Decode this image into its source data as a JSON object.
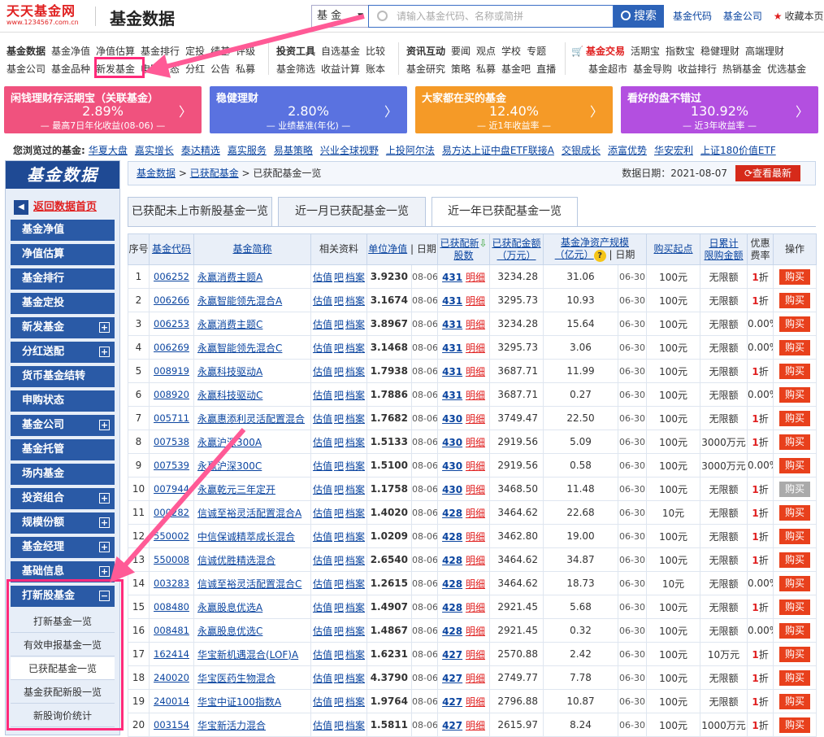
{
  "header": {
    "logo_text": "天天基金网",
    "logo_url": "www.1234567.com.cn",
    "site_title": "基金数据",
    "search_type": "基 金",
    "search_placeholder": "请输入基金代码、名称或简拼",
    "search_button": "搜索",
    "link_code": "基金代码",
    "link_company": "基金公司",
    "bookmark": "收藏本页"
  },
  "nav": {
    "g1r1": [
      "基金数据",
      "基金净值",
      "净值估算",
      "基金排行",
      "定投",
      "绩基",
      "评级"
    ],
    "g1r2": [
      "基金公司",
      "基金品种",
      "新发基金",
      "申购状态",
      "分红",
      "公告",
      "私募"
    ],
    "g2r1": [
      "投资工具",
      "自选基金",
      "比较"
    ],
    "g2r2": [
      "基金筛选",
      "收益计算",
      "账本"
    ],
    "g3r1": [
      "资讯互动",
      "要闻",
      "观点",
      "学校",
      "专题"
    ],
    "g3r2": [
      "基金研究",
      "策略",
      "私募",
      "基金吧",
      "直播"
    ],
    "g4r1": [
      "基金交易",
      "活期宝",
      "指数宝",
      "稳健理财",
      "高端理财"
    ],
    "g4r2": [
      "基金超市",
      "基金导购",
      "收益排行",
      "热销基金",
      "优选基金"
    ]
  },
  "banners": [
    {
      "title": "闲钱理财存活期宝（关联基金）",
      "value": "2.89%",
      "sub": "— 最高7日年化收益(08-06) —",
      "color": "#f0527e"
    },
    {
      "title": "稳健理财",
      "value": "2.80%",
      "sub": "— 业绩基准(年化) —",
      "color": "#5a72e0"
    },
    {
      "title": "大家都在买的基金",
      "value": "12.40%",
      "sub": "— 近1年收益率 —",
      "color": "#f59a27"
    },
    {
      "title": "看好的盘不错过",
      "value": "130.92%",
      "sub": "— 近3年收益率 —",
      "color": "#b34fe0"
    }
  ],
  "history": {
    "label": "您浏览过的基金:",
    "items": [
      "华夏大盘",
      "嘉实增长",
      "泰达精选",
      "嘉实服务",
      "易基策略",
      "兴业全球视野",
      "上投阿尔法",
      "易方达上证中盘ETF联接A",
      "交银成长",
      "添富优势",
      "华安宏利",
      "上证180价值ETF"
    ]
  },
  "sidebar": {
    "title": "基金数据",
    "back": "返回数据首页",
    "items": [
      {
        "label": "基金净值",
        "plus": false
      },
      {
        "label": "净值估算",
        "plus": false
      },
      {
        "label": "基金排行",
        "plus": false
      },
      {
        "label": "基金定投",
        "plus": false
      },
      {
        "label": "新发基金",
        "plus": true
      },
      {
        "label": "分红送配",
        "plus": true
      },
      {
        "label": "货币基金结转",
        "plus": false
      },
      {
        "label": "申购状态",
        "plus": false
      },
      {
        "label": "基金公司",
        "plus": true
      },
      {
        "label": "基金托管",
        "plus": false
      },
      {
        "label": "场内基金",
        "plus": false
      },
      {
        "label": "投资组合",
        "plus": true
      },
      {
        "label": "规模份额",
        "plus": true
      },
      {
        "label": "基金经理",
        "plus": true
      },
      {
        "label": "基础信息",
        "plus": true
      }
    ],
    "expanded": {
      "label": "打新股基金",
      "sub": [
        "打新基金一览",
        "有效申报基金一览",
        "已获配基金一览",
        "基金获配新股一览",
        "新股询价统计"
      ],
      "current": 2
    }
  },
  "breadcrumb": {
    "items": [
      "基金数据",
      "已获配基金",
      "已获配基金一览"
    ],
    "date_label": "数据日期：",
    "date": "2021-08-07",
    "btn": "查看最新"
  },
  "tabs": [
    {
      "label": "已获配未上市新股基金一览"
    },
    {
      "label": "近一月已获配基金一览"
    },
    {
      "label": "近一年已获配基金一览"
    }
  ],
  "table": {
    "headers": {
      "idx": "序号",
      "code": "基金代码",
      "name": "基金简称",
      "rel": "相关资料",
      "nav": "单位净值",
      "date": "日期",
      "cnt1": "已获配新",
      "cnt2": "股数",
      "amt1": "已获配金额",
      "amt2": "（万元）",
      "scale1": "基金净资产规模",
      "scale2": "（亿元）",
      "sdate": "日期",
      "min": "购买起点",
      "lim1": "日累计",
      "lim2": "限购金额",
      "fee1": "优惠",
      "fee2": "费率",
      "op": "操作"
    },
    "rel_links": [
      "估值",
      "吧",
      "档案"
    ],
    "detail": "明细",
    "buy": "购买",
    "fee_unit": "折",
    "rows": [
      {
        "i": "1",
        "code": "006252",
        "name": "永赢消费主题A",
        "nav": "3.9230",
        "d": "08-06",
        "cnt": "431",
        "amt": "3234.28",
        "scale": "31.06",
        "sd": "06-30",
        "min": "100元",
        "lim": "无限额",
        "fee": "1",
        "buy": "购买"
      },
      {
        "i": "2",
        "code": "006266",
        "name": "永赢智能领先混合A",
        "nav": "3.1674",
        "d": "08-06",
        "cnt": "431",
        "amt": "3295.73",
        "scale": "10.93",
        "sd": "06-30",
        "min": "100元",
        "lim": "无限额",
        "fee": "1",
        "buy": "购买"
      },
      {
        "i": "3",
        "code": "006253",
        "name": "永赢消费主题C",
        "nav": "3.8967",
        "d": "08-06",
        "cnt": "431",
        "amt": "3234.28",
        "scale": "15.64",
        "sd": "06-30",
        "min": "100元",
        "lim": "无限额",
        "fee": "0.00%",
        "buy": "购买"
      },
      {
        "i": "4",
        "code": "006269",
        "name": "永赢智能领先混合C",
        "nav": "3.1468",
        "d": "08-06",
        "cnt": "431",
        "amt": "3295.73",
        "scale": "3.06",
        "sd": "06-30",
        "min": "100元",
        "lim": "无限额",
        "fee": "0.00%",
        "buy": "购买"
      },
      {
        "i": "5",
        "code": "008919",
        "name": "永赢科技驱动A",
        "nav": "1.7938",
        "d": "08-06",
        "cnt": "431",
        "amt": "3687.71",
        "scale": "11.99",
        "sd": "06-30",
        "min": "100元",
        "lim": "无限额",
        "fee": "1",
        "buy": "购买"
      },
      {
        "i": "6",
        "code": "008920",
        "name": "永赢科技驱动C",
        "nav": "1.7886",
        "d": "08-06",
        "cnt": "431",
        "amt": "3687.71",
        "scale": "0.27",
        "sd": "06-30",
        "min": "100元",
        "lim": "无限额",
        "fee": "0.00%",
        "buy": "购买"
      },
      {
        "i": "7",
        "code": "005711",
        "name": "永赢惠添利灵活配置混合",
        "nav": "1.7682",
        "d": "08-06",
        "cnt": "430",
        "amt": "3749.47",
        "scale": "22.50",
        "sd": "06-30",
        "min": "100元",
        "lim": "无限额",
        "fee": "1",
        "buy": "购买"
      },
      {
        "i": "8",
        "code": "007538",
        "name": "永赢沪深300A",
        "nav": "1.5133",
        "d": "08-06",
        "cnt": "430",
        "amt": "2919.56",
        "scale": "5.09",
        "sd": "06-30",
        "min": "100元",
        "lim": "3000万元",
        "fee": "1",
        "buy": "购买"
      },
      {
        "i": "9",
        "code": "007539",
        "name": "永赢沪深300C",
        "nav": "1.5100",
        "d": "08-06",
        "cnt": "430",
        "amt": "2919.56",
        "scale": "0.58",
        "sd": "06-30",
        "min": "100元",
        "lim": "3000万元",
        "fee": "0.00%",
        "buy": "购买"
      },
      {
        "i": "10",
        "code": "007944",
        "name": "永赢乾元三年定开",
        "nav": "1.1758",
        "d": "08-06",
        "cnt": "430",
        "amt": "3468.50",
        "scale": "11.48",
        "sd": "06-30",
        "min": "100元",
        "lim": "无限额",
        "fee": "1",
        "buy": "购买",
        "dis": true
      },
      {
        "i": "11",
        "code": "000282",
        "name": "信诚至裕灵活配置混合A",
        "nav": "1.4020",
        "d": "08-06",
        "cnt": "428",
        "amt": "3464.62",
        "scale": "22.68",
        "sd": "06-30",
        "min": "10元",
        "lim": "无限额",
        "fee": "1",
        "buy": "购买"
      },
      {
        "i": "12",
        "code": "550002",
        "name": "中信保诚精萃成长混合",
        "nav": "1.0209",
        "d": "08-06",
        "cnt": "428",
        "amt": "3462.80",
        "scale": "19.00",
        "sd": "06-30",
        "min": "100元",
        "lim": "无限额",
        "fee": "1",
        "buy": "购买"
      },
      {
        "i": "13",
        "code": "550008",
        "name": "信诚优胜精选混合",
        "nav": "2.6540",
        "d": "08-06",
        "cnt": "428",
        "amt": "3464.62",
        "scale": "34.87",
        "sd": "06-30",
        "min": "100元",
        "lim": "无限额",
        "fee": "1",
        "buy": "购买"
      },
      {
        "i": "14",
        "code": "003283",
        "name": "信诚至裕灵活配置混合C",
        "nav": "1.2615",
        "d": "08-06",
        "cnt": "428",
        "amt": "3464.62",
        "scale": "18.73",
        "sd": "06-30",
        "min": "10元",
        "lim": "无限额",
        "fee": "0.00%",
        "buy": "购买"
      },
      {
        "i": "15",
        "code": "008480",
        "name": "永赢股息优选A",
        "nav": "1.4907",
        "d": "08-06",
        "cnt": "428",
        "amt": "2921.45",
        "scale": "5.68",
        "sd": "06-30",
        "min": "100元",
        "lim": "无限额",
        "fee": "1",
        "buy": "购买"
      },
      {
        "i": "16",
        "code": "008481",
        "name": "永赢股息优选C",
        "nav": "1.4867",
        "d": "08-06",
        "cnt": "428",
        "amt": "2921.45",
        "scale": "0.32",
        "sd": "06-30",
        "min": "100元",
        "lim": "无限额",
        "fee": "0.00%",
        "buy": "购买"
      },
      {
        "i": "17",
        "code": "162414",
        "name": "华宝新机遇混合(LOF)A",
        "nav": "1.6231",
        "d": "08-06",
        "cnt": "427",
        "amt": "2570.88",
        "scale": "2.42",
        "sd": "06-30",
        "min": "100元",
        "lim": "10万元",
        "fee": "1",
        "buy": "购买"
      },
      {
        "i": "18",
        "code": "240020",
        "name": "华宝医药生物混合",
        "nav": "4.3790",
        "d": "08-06",
        "cnt": "427",
        "amt": "2749.77",
        "scale": "7.78",
        "sd": "06-30",
        "min": "100元",
        "lim": "无限额",
        "fee": "1",
        "buy": "购买"
      },
      {
        "i": "19",
        "code": "240014",
        "name": "华宝中证100指数A",
        "nav": "1.9764",
        "d": "08-06",
        "cnt": "427",
        "amt": "2796.88",
        "scale": "10.87",
        "sd": "06-30",
        "min": "100元",
        "lim": "无限额",
        "fee": "1",
        "buy": "购买"
      },
      {
        "i": "20",
        "code": "003154",
        "name": "华宝新活力混合",
        "nav": "1.5811",
        "d": "08-06",
        "cnt": "427",
        "amt": "2615.97",
        "scale": "8.24",
        "sd": "06-30",
        "min": "100元",
        "lim": "1000万元",
        "fee": "1",
        "buy": "购买"
      }
    ]
  },
  "colors": {
    "accent": "#2a5aa6",
    "buy": "#e8401c",
    "highlight": "#ff2a7a",
    "link": "#0b45a0"
  }
}
